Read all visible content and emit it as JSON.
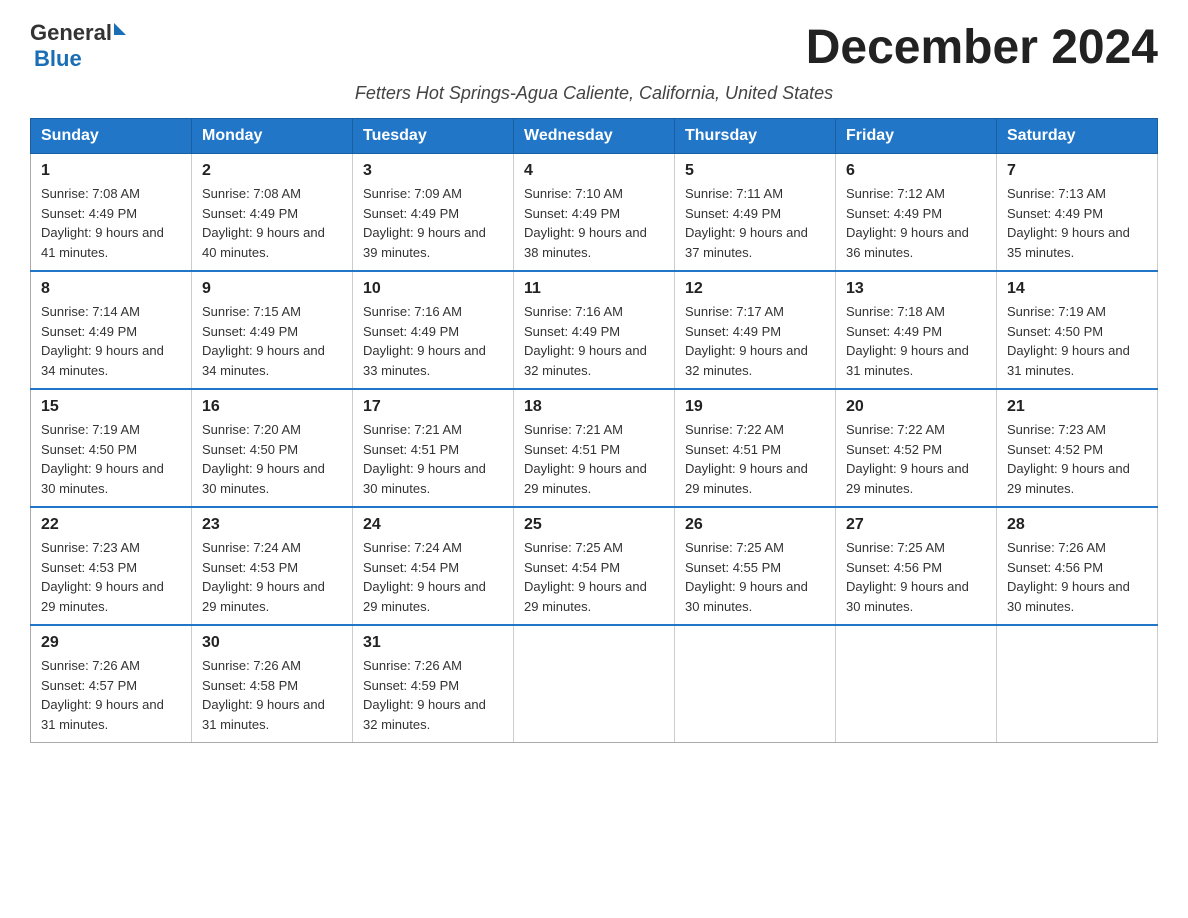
{
  "header": {
    "logo": {
      "general": "General",
      "blue": "Blue"
    },
    "title": "December 2024",
    "subtitle": "Fetters Hot Springs-Agua Caliente, California, United States"
  },
  "weekdays": [
    "Sunday",
    "Monday",
    "Tuesday",
    "Wednesday",
    "Thursday",
    "Friday",
    "Saturday"
  ],
  "weeks": [
    [
      {
        "day": "1",
        "sunrise": "7:08 AM",
        "sunset": "4:49 PM",
        "daylight": "9 hours and 41 minutes."
      },
      {
        "day": "2",
        "sunrise": "7:08 AM",
        "sunset": "4:49 PM",
        "daylight": "9 hours and 40 minutes."
      },
      {
        "day": "3",
        "sunrise": "7:09 AM",
        "sunset": "4:49 PM",
        "daylight": "9 hours and 39 minutes."
      },
      {
        "day": "4",
        "sunrise": "7:10 AM",
        "sunset": "4:49 PM",
        "daylight": "9 hours and 38 minutes."
      },
      {
        "day": "5",
        "sunrise": "7:11 AM",
        "sunset": "4:49 PM",
        "daylight": "9 hours and 37 minutes."
      },
      {
        "day": "6",
        "sunrise": "7:12 AM",
        "sunset": "4:49 PM",
        "daylight": "9 hours and 36 minutes."
      },
      {
        "day": "7",
        "sunrise": "7:13 AM",
        "sunset": "4:49 PM",
        "daylight": "9 hours and 35 minutes."
      }
    ],
    [
      {
        "day": "8",
        "sunrise": "7:14 AM",
        "sunset": "4:49 PM",
        "daylight": "9 hours and 34 minutes."
      },
      {
        "day": "9",
        "sunrise": "7:15 AM",
        "sunset": "4:49 PM",
        "daylight": "9 hours and 34 minutes."
      },
      {
        "day": "10",
        "sunrise": "7:16 AM",
        "sunset": "4:49 PM",
        "daylight": "9 hours and 33 minutes."
      },
      {
        "day": "11",
        "sunrise": "7:16 AM",
        "sunset": "4:49 PM",
        "daylight": "9 hours and 32 minutes."
      },
      {
        "day": "12",
        "sunrise": "7:17 AM",
        "sunset": "4:49 PM",
        "daylight": "9 hours and 32 minutes."
      },
      {
        "day": "13",
        "sunrise": "7:18 AM",
        "sunset": "4:49 PM",
        "daylight": "9 hours and 31 minutes."
      },
      {
        "day": "14",
        "sunrise": "7:19 AM",
        "sunset": "4:50 PM",
        "daylight": "9 hours and 31 minutes."
      }
    ],
    [
      {
        "day": "15",
        "sunrise": "7:19 AM",
        "sunset": "4:50 PM",
        "daylight": "9 hours and 30 minutes."
      },
      {
        "day": "16",
        "sunrise": "7:20 AM",
        "sunset": "4:50 PM",
        "daylight": "9 hours and 30 minutes."
      },
      {
        "day": "17",
        "sunrise": "7:21 AM",
        "sunset": "4:51 PM",
        "daylight": "9 hours and 30 minutes."
      },
      {
        "day": "18",
        "sunrise": "7:21 AM",
        "sunset": "4:51 PM",
        "daylight": "9 hours and 29 minutes."
      },
      {
        "day": "19",
        "sunrise": "7:22 AM",
        "sunset": "4:51 PM",
        "daylight": "9 hours and 29 minutes."
      },
      {
        "day": "20",
        "sunrise": "7:22 AM",
        "sunset": "4:52 PM",
        "daylight": "9 hours and 29 minutes."
      },
      {
        "day": "21",
        "sunrise": "7:23 AM",
        "sunset": "4:52 PM",
        "daylight": "9 hours and 29 minutes."
      }
    ],
    [
      {
        "day": "22",
        "sunrise": "7:23 AM",
        "sunset": "4:53 PM",
        "daylight": "9 hours and 29 minutes."
      },
      {
        "day": "23",
        "sunrise": "7:24 AM",
        "sunset": "4:53 PM",
        "daylight": "9 hours and 29 minutes."
      },
      {
        "day": "24",
        "sunrise": "7:24 AM",
        "sunset": "4:54 PM",
        "daylight": "9 hours and 29 minutes."
      },
      {
        "day": "25",
        "sunrise": "7:25 AM",
        "sunset": "4:54 PM",
        "daylight": "9 hours and 29 minutes."
      },
      {
        "day": "26",
        "sunrise": "7:25 AM",
        "sunset": "4:55 PM",
        "daylight": "9 hours and 30 minutes."
      },
      {
        "day": "27",
        "sunrise": "7:25 AM",
        "sunset": "4:56 PM",
        "daylight": "9 hours and 30 minutes."
      },
      {
        "day": "28",
        "sunrise": "7:26 AM",
        "sunset": "4:56 PM",
        "daylight": "9 hours and 30 minutes."
      }
    ],
    [
      {
        "day": "29",
        "sunrise": "7:26 AM",
        "sunset": "4:57 PM",
        "daylight": "9 hours and 31 minutes."
      },
      {
        "day": "30",
        "sunrise": "7:26 AM",
        "sunset": "4:58 PM",
        "daylight": "9 hours and 31 minutes."
      },
      {
        "day": "31",
        "sunrise": "7:26 AM",
        "sunset": "4:59 PM",
        "daylight": "9 hours and 32 minutes."
      },
      null,
      null,
      null,
      null
    ]
  ]
}
